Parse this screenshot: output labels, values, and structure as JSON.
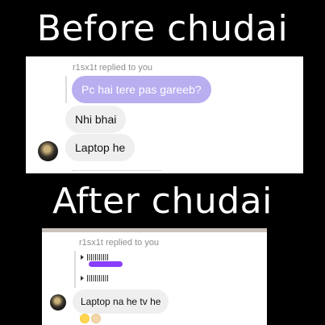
{
  "captions": {
    "before": "Before chudai",
    "after": "After chudai"
  },
  "before_chat": {
    "replied_label": "r1sx1t replied to you",
    "quoted_message": "Pc hai tere pas gareeb?",
    "replies": [
      "Nhi bhai",
      "Laptop he"
    ]
  },
  "after_chat": {
    "replied_label": "r1sx1t replied to you",
    "reply": "Laptop na he tv he",
    "reactions": [
      "laughing-emoji",
      "face-emoji"
    ]
  },
  "colors": {
    "quoted_bubble": "#b8aef0",
    "reply_bubble": "#efefef",
    "voice_tag": "#8a3ffc"
  }
}
